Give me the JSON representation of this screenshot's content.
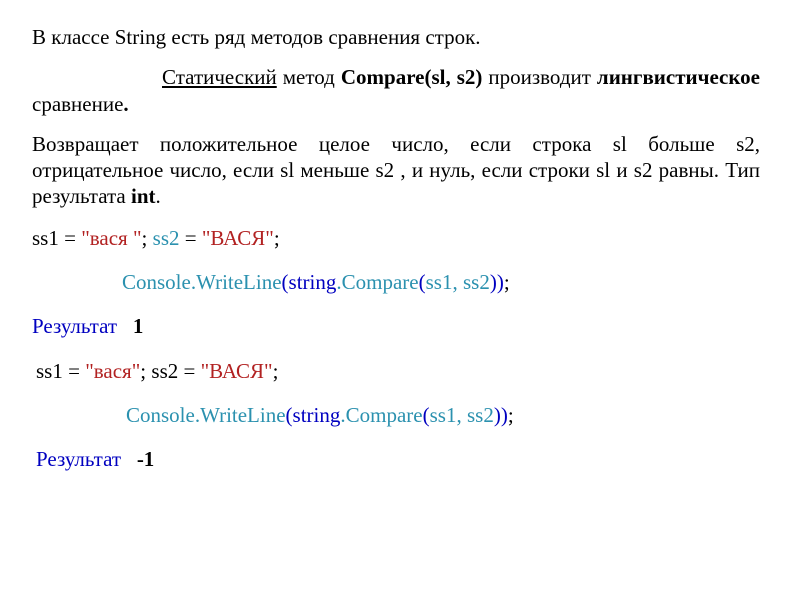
{
  "p1": "В классе String есть ряд методов сравнения строк.",
  "p2": {
    "t1": "Статический",
    "t2": " метод   ",
    "t3": "Compare(sl, s2)",
    "t4": "  производит ",
    "t5": "лингвистическое",
    "t6": " сравнение",
    "t7": "."
  },
  "p3": {
    "t1": "Возвращает положительное целое число, если строка sl больше s2, отрицательное число, если sl меньше s2 , и нуль, если строки sl и s2 равны. Тип результата ",
    "t2": "int",
    "t3": "."
  },
  "ex1": {
    "assign": {
      "s1_var": "ss1",
      "eq1": " = ",
      "s1_val": "\"вася   \"",
      "sep": "; ",
      "s2_var": "ss2",
      "eq2": " = ",
      "s2_val": "\"ВАСЯ\"",
      "end": ";"
    },
    "call": {
      "console": "Console",
      "dot1": ".",
      "writeline": "WriteLine",
      "lp": "(",
      "string": "string",
      "dot2": ".",
      "compare": "Compare",
      "lp2": "(",
      "arg1": "ss1",
      "comma": ", ",
      "arg2": "ss2",
      "rp": "))",
      "end": ";"
    },
    "result_label": "Результат",
    "result_val": "1"
  },
  "ex2": {
    "assign": {
      "s1_var": "ss1",
      "eq1": " = ",
      "s1_val": "\"вася\"",
      "sep": ";  ",
      "s2_var": "ss2",
      "eq2": " = ",
      "s2_val": "\"ВАСЯ\"",
      "end": ";"
    },
    "call": {
      "console": "Console",
      "dot1": ".",
      "writeline": "WriteLine",
      "lp": "(",
      "string": "string",
      "dot2": ".",
      "compare": "Compare",
      "lp2": "(",
      "arg1": "ss1",
      "comma": ", ",
      "arg2": "ss2",
      "rp": "))",
      "end": ";"
    },
    "result_label": "Результат",
    "result_val": "-1"
  }
}
